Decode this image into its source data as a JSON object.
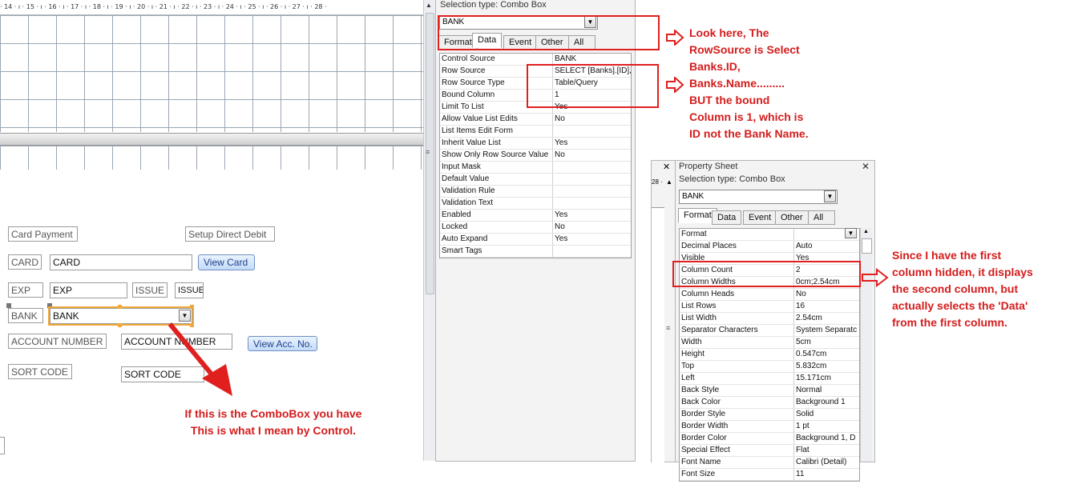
{
  "ruler": {
    "text": "· 14 · ı · 15 · ı · 16 · ı · 17 · ı · 18 · ı · 19 · ı · 20 · ı · 21 · ı · 22 · ı · 23 · ı · 24 · ı · 25 · ı · 26 · ı · 27 · ı · 28 ·"
  },
  "form": {
    "card_payment_label": "Card Payment",
    "setup_dd_label": "Setup Direct Debit",
    "card_label": "CARD",
    "card_field": "CARD",
    "view_card_button": "View Card",
    "exp_label": "EXP",
    "exp_field": "EXP",
    "issue_label": "ISSUE",
    "issue_field": "ISSUE",
    "bank_label": "BANK",
    "bank_combo": "BANK",
    "account_label": "ACCOUNT NUMBER",
    "account_field": "ACCOUNT NUMBER",
    "view_acc_button": "View Acc. No.",
    "sort_label": "SORT CODE",
    "sort_field": "SORT CODE"
  },
  "sheet1": {
    "selection_type": "Selection type:  Combo Box",
    "selected_control": "BANK",
    "tabs": [
      "Format",
      "Data",
      "Event",
      "Other",
      "All"
    ],
    "active_tab": "Data",
    "rows": [
      {
        "k": "Control Source",
        "v": "BANK"
      },
      {
        "k": "Row Source",
        "v": "SELECT [Banks].[ID],"
      },
      {
        "k": "Row Source Type",
        "v": "Table/Query"
      },
      {
        "k": "Bound Column",
        "v": "1"
      },
      {
        "k": "Limit To List",
        "v": "Yes"
      },
      {
        "k": "Allow Value List Edits",
        "v": "No"
      },
      {
        "k": "List Items Edit Form",
        "v": ""
      },
      {
        "k": "Inherit Value List",
        "v": "Yes"
      },
      {
        "k": "Show Only Row Source Value",
        "v": "No"
      },
      {
        "k": "Input Mask",
        "v": ""
      },
      {
        "k": "Default Value",
        "v": ""
      },
      {
        "k": "Validation Rule",
        "v": ""
      },
      {
        "k": "Validation Text",
        "v": ""
      },
      {
        "k": "Enabled",
        "v": "Yes"
      },
      {
        "k": "Locked",
        "v": "No"
      },
      {
        "k": "Auto Expand",
        "v": "Yes"
      },
      {
        "k": "Smart Tags",
        "v": ""
      }
    ]
  },
  "sheet2": {
    "title": "Property Sheet",
    "close": "✕",
    "selection_type": "Selection type:  Combo Box",
    "selected_control": "BANK",
    "tabs": [
      "Format",
      "Data",
      "Event",
      "Other",
      "All"
    ],
    "active_tab": "Format",
    "rows": [
      {
        "k": "Format",
        "v": ""
      },
      {
        "k": "Decimal Places",
        "v": "Auto"
      },
      {
        "k": "Visible",
        "v": "Yes"
      },
      {
        "k": "Column Count",
        "v": "2"
      },
      {
        "k": "Column Widths",
        "v": "0cm;2.54cm"
      },
      {
        "k": "Column Heads",
        "v": "No"
      },
      {
        "k": "List Rows",
        "v": "16"
      },
      {
        "k": "List Width",
        "v": "2.54cm"
      },
      {
        "k": "Separator Characters",
        "v": "System Separatc"
      },
      {
        "k": "Width",
        "v": "5cm"
      },
      {
        "k": "Height",
        "v": "0.547cm"
      },
      {
        "k": "Top",
        "v": "5.832cm"
      },
      {
        "k": "Left",
        "v": "15.171cm"
      },
      {
        "k": "Back Style",
        "v": "Normal"
      },
      {
        "k": "Back Color",
        "v": "Background 1"
      },
      {
        "k": "Border Style",
        "v": "Solid"
      },
      {
        "k": "Border Width",
        "v": "1 pt"
      },
      {
        "k": "Border Color",
        "v": "Background 1, D"
      },
      {
        "k": "Special Effect",
        "v": "Flat"
      },
      {
        "k": "Font Name",
        "v": "Calibri (Detail)"
      },
      {
        "k": "Font Size",
        "v": "11"
      }
    ],
    "left_x": "✕",
    "left_ruler": "28 ·"
  },
  "notes": {
    "note1": [
      "Look here, The",
      "RowSource is Select",
      "Banks.ID,",
      "Banks.Name.........",
      "BUT the bound",
      "Column is 1, which is",
      "ID not the Bank Name."
    ],
    "note2": [
      "Since I have the first",
      "column hidden, it displays",
      "the second column, but",
      "actually selects the 'Data'",
      "from the first column."
    ],
    "note3": [
      "If this is the ComboBox you have",
      "This is what I mean by Control."
    ]
  },
  "colors": {
    "annotation": "#d41c1c",
    "selection": "#f0a838"
  }
}
